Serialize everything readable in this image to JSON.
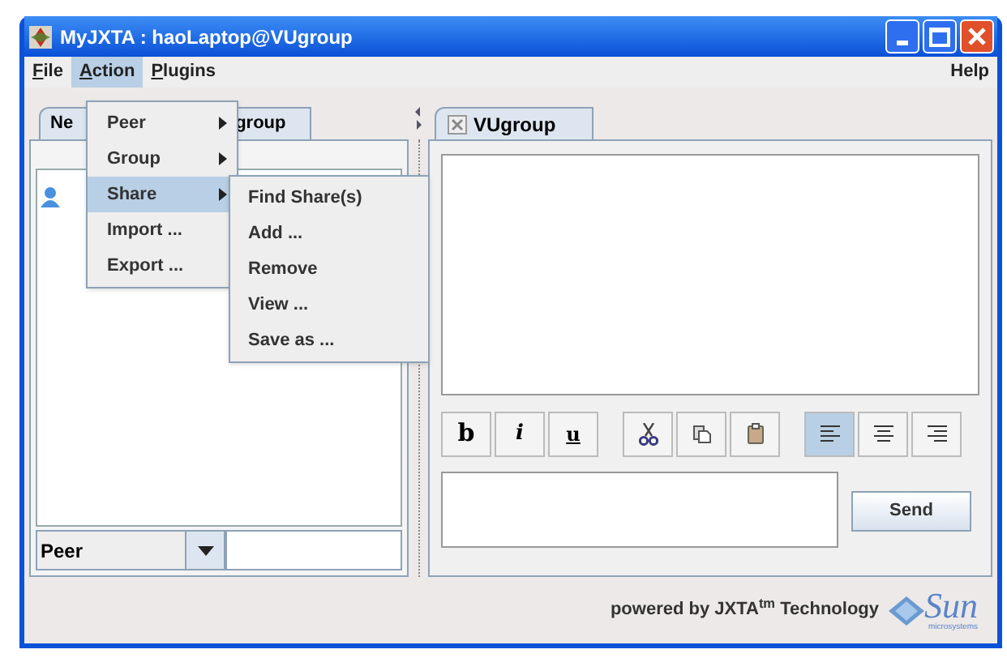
{
  "window": {
    "title": "MyJXTA : haoLaptop@VUgroup"
  },
  "menu_bar": {
    "items": [
      {
        "label": "File",
        "selected": false
      },
      {
        "label": "Action",
        "selected": true
      },
      {
        "label": "Plugins",
        "selected": false
      }
    ],
    "help": "Help"
  },
  "action_menu": [
    {
      "label": "Peer",
      "submenu": true,
      "selected": false
    },
    {
      "label": "Group",
      "submenu": true,
      "selected": false
    },
    {
      "label": "Share",
      "submenu": true,
      "selected": true
    },
    {
      "label": "Import ...",
      "submenu": false,
      "selected": false
    },
    {
      "label": "Export ...",
      "submenu": false,
      "selected": false
    }
  ],
  "share_submenu": [
    "Find Share(s)",
    "Add ...",
    "Remove",
    "View ...",
    "Save as ..."
  ],
  "left_panel": {
    "tab_text_start": "Ne",
    "tab_text_end": "group",
    "search_type": "Peer"
  },
  "chat_tab": {
    "label": "VUgroup"
  },
  "toolbar": [
    {
      "kind": "text",
      "label": "b",
      "selected": false
    },
    {
      "kind": "text",
      "label": "i",
      "selected": false
    },
    {
      "kind": "text",
      "label": "u",
      "selected": false
    },
    {
      "kind": "cut",
      "selected": false
    },
    {
      "kind": "copy",
      "selected": false
    },
    {
      "kind": "paste",
      "selected": false
    },
    {
      "kind": "align-left",
      "selected": true
    },
    {
      "kind": "align-center",
      "selected": false
    },
    {
      "kind": "align-right",
      "selected": false
    }
  ],
  "send_button": "Send",
  "footer": {
    "text": "powered by JXTA$^{tm}$ Technology",
    "logo_text": "Sun",
    "logo_subtext": "microsystems"
  }
}
